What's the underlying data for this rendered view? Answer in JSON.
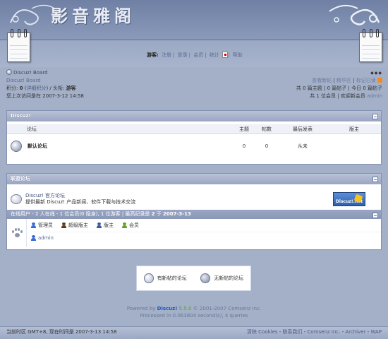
{
  "header": {
    "logo_text": "影音雅阁",
    "guest_label": "游客:",
    "nav": [
      "注册",
      "登录",
      "会员",
      "统计",
      "帮助"
    ]
  },
  "info_left": {
    "board_title": "Discuz! Board",
    "board_sub": "Discuz! Board",
    "credits_label": "积分:",
    "credits_value": "0",
    "detail_link": "详细积分",
    "title_label": "头衔:",
    "title_value": "游客",
    "last_visit_label": "您上次访问是在",
    "last_visit_value": "2007-3-12 14:58"
  },
  "info_right": {
    "arrows": "◆◆◆",
    "links": [
      "查看新帖",
      "精华区",
      "标记已读"
    ],
    "stats_line": "共 0 篇主题 | 0 篇帖子 | 今日 0 篇帖子",
    "members_line": "共 1 位会员 | 欢迎新会员",
    "newest_member": "admin"
  },
  "forums_box": {
    "title": "Discuz!",
    "columns": [
      "论坛",
      "主题",
      "帖数",
      "最后发表",
      "版主"
    ],
    "rows": [
      {
        "name": "默认论坛",
        "topics": "0",
        "posts": "0",
        "last_post": "从未",
        "moderator": ""
      }
    ]
  },
  "partners_box": {
    "title": "联盟论坛",
    "name": "Discuz! 官方论坛",
    "description": "提供最新 Discuz! 产品新闻、软件下载与技术交流",
    "logo_text": "Discuz!.net"
  },
  "online_box": {
    "title": "在线用户",
    "summary_prefix": "- 2 人在线 - 1 位会员(0 隐身), 1 位游客 | 最高纪录是",
    "record_count": "2",
    "record_on": "于",
    "record_date": "2007-3-13",
    "groups": [
      {
        "label": "管理员",
        "color": "#3b6bd1"
      },
      {
        "label": "超级版主",
        "color": "#5d3a1a"
      },
      {
        "label": "版主",
        "color": "#3a5a9a"
      },
      {
        "label": "会员",
        "color": "#6aa02a"
      }
    ],
    "online_user": "admin"
  },
  "legend": {
    "new_label": "有新帖的论坛",
    "old_label": "无新帖的论坛"
  },
  "powered": {
    "prefix": "Powered by",
    "brand": "Discuz!",
    "version": "5.5.0",
    "copyright": "© 2001-2007 Comsenz Inc.",
    "processed": "Processed in 0.063804 second(s), 4 queries"
  },
  "footer": {
    "timezone": "当前时区 GMT+8, 现在时间是 2007-3-13 14:58",
    "links": [
      "清除 Cookies",
      "联系我们",
      "Comsenz Inc.",
      "Archiver",
      "WAP"
    ]
  },
  "colors": {
    "background": "#a3b0c8",
    "header_bar": "#9aa6c2",
    "brand": "#2156b5"
  }
}
